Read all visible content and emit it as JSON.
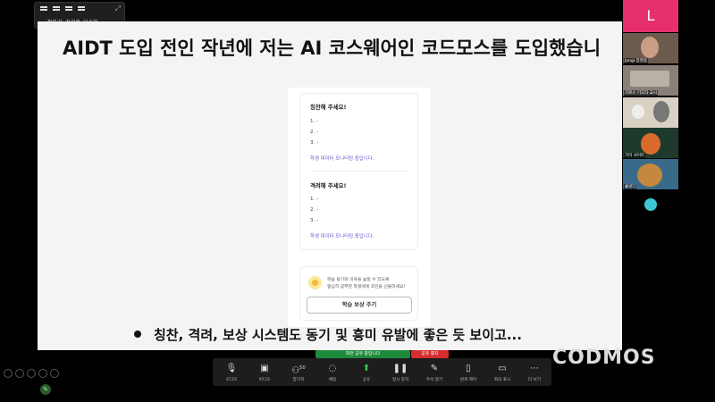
{
  "speaker": {
    "label": "활하기: 장광중_이승협"
  },
  "slide": {
    "title": "AIDT 도입 전인 작년에 저는 AI 코스웨어인 코드모스를 도입했습니",
    "card": {
      "praise_heading": "칭찬해 주세요!",
      "praise_items": [
        "1. -",
        "2. -",
        "3. -"
      ],
      "praise_monitor": "학생 데이터 모니터링 중입니다.",
      "encourage_heading": "격려해 주세요!",
      "encourage_items": [
        "1. -",
        "2. -",
        "3. -"
      ],
      "encourage_monitor": "학생 데이터 모니터링 중입니다.",
      "reward_line1": "학습 동기와 의욕을 높일 수 있도록",
      "reward_line2": "열심히 공부한 학생에게 코인을 선물하세요!",
      "reward_button": "학습 보상 주기"
    },
    "bullet": "칭찬, 격려, 보상 시스템도 동기 및 흥미 유발에 좋은 듯 보이고..."
  },
  "self_tile": {
    "initial": "L"
  },
  "participants": [
    {
      "label": "Jungi 장명중"
    },
    {
      "label": "기로스 기도타 교시"
    },
    {
      "label": ""
    },
    {
      "label": "기이 사이트"
    },
    {
      "label": "흘렀다"
    }
  ],
  "status": {
    "sharing": "화면 공유 중입니다",
    "stop": "공유 중지"
  },
  "toolbar": [
    {
      "icon": "microphone-icon",
      "glyph": "🎙",
      "label": "오디오"
    },
    {
      "icon": "video-camera-icon",
      "glyph": "📹",
      "label": "비디오"
    },
    {
      "icon": "participants-icon",
      "glyph": "👥",
      "label": "참가자",
      "count": "50"
    },
    {
      "icon": "chat-icon",
      "glyph": "💬",
      "label": "채팅"
    },
    {
      "icon": "share-screen-icon",
      "glyph": "⬆",
      "label": "공유"
    },
    {
      "icon": "pause-share-icon",
      "glyph": "⏸",
      "label": "일시 중지"
    },
    {
      "icon": "annotate-icon",
      "glyph": "✎",
      "label": "주석 달기"
    },
    {
      "icon": "remote-control-icon",
      "glyph": "🖱",
      "label": "원격 제어"
    },
    {
      "icon": "whiteboard-icon",
      "glyph": "▭",
      "label": "회의 표시"
    },
    {
      "icon": "more-icon",
      "glyph": "⋯",
      "label": "더 보기"
    }
  ],
  "brand": "CODMOS"
}
